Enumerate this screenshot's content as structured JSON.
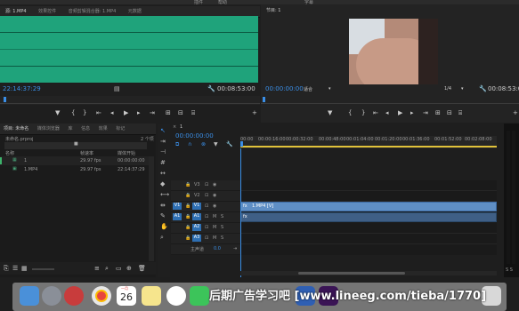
{
  "menu": {
    "items": [
      "插件",
      "帮助",
      "字幕"
    ]
  },
  "source_panel": {
    "tabs": [
      "源: 1.MP4",
      "效果控件",
      "音频剪辑混合器: 1.MP4",
      "元数据"
    ],
    "timecode_in": "22:14:37:29",
    "duration": "00:08:53:00"
  },
  "program_panel": {
    "title": "节目: 1",
    "timecode": "00:00:00:00",
    "fit": "适合",
    "resolution": "1/4",
    "duration": "00:08:53:00"
  },
  "project_panel": {
    "tabs": [
      "项目: 未命名",
      "媒体浏览器",
      "库",
      "信息",
      "效果",
      "标记"
    ],
    "project_file": "未命名.prproj",
    "item_count": "2 个项",
    "columns": [
      "名称",
      "帧速率",
      "媒体开始"
    ],
    "items": [
      {
        "name": "1",
        "fps": "29.97 fps",
        "start": "00:00:00:00"
      },
      {
        "name": "1.MP4",
        "fps": "29.97 fps",
        "start": "22:14:37:29"
      }
    ]
  },
  "timeline": {
    "tab": "1",
    "timecode": "00:00:00:00",
    "ruler": [
      "00:00",
      "00:00:16:00",
      "00:00:32:00",
      "00:00:48:00",
      "00:01:04:00",
      "00:01:20:00",
      "00:01:36:00",
      "00:01:52:00",
      "00:02:08:00"
    ],
    "video_tracks": [
      "V3",
      "V2",
      "V1"
    ],
    "audio_tracks": [
      "A1",
      "A2",
      "A3"
    ],
    "master_label": "主声道",
    "master_value": "0.0",
    "clip_label": "1.MP4 [V]",
    "src_v": "V1",
    "src_a": "A1",
    "m_label": "M",
    "s_label": "S",
    "meter_label": "S S"
  },
  "watermark": "后期广告学习吧 [www.lineeg.com/tieba/1770]",
  "dock": {
    "calendar_day": "26",
    "calendar_month": "一月"
  }
}
